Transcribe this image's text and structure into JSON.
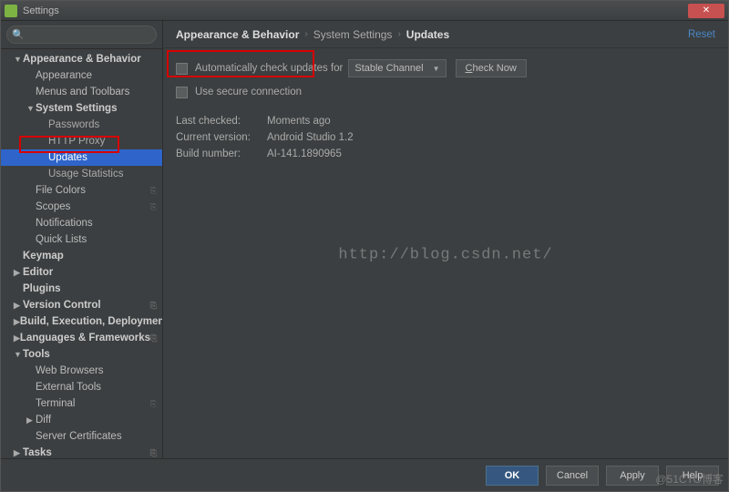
{
  "title": "Settings",
  "search": {
    "placeholder": ""
  },
  "sidebar": {
    "items": [
      {
        "label": "Appearance & Behavior",
        "level": 1,
        "arrow": "▼"
      },
      {
        "label": "Appearance",
        "level": 2,
        "plain": true
      },
      {
        "label": "Menus and Toolbars",
        "level": 2,
        "plain": true
      },
      {
        "label": "System Settings",
        "level": 2,
        "arrow": "▼"
      },
      {
        "label": "Passwords",
        "level": 3
      },
      {
        "label": "HTTP Proxy",
        "level": 3
      },
      {
        "label": "Updates",
        "level": 3,
        "selected": true
      },
      {
        "label": "Usage Statistics",
        "level": 3
      },
      {
        "label": "File Colors",
        "level": 2,
        "plain": true,
        "config": true
      },
      {
        "label": "Scopes",
        "level": 2,
        "plain": true,
        "config": true
      },
      {
        "label": "Notifications",
        "level": 2,
        "plain": true
      },
      {
        "label": "Quick Lists",
        "level": 2,
        "plain": true
      },
      {
        "label": "Keymap",
        "level": 1
      },
      {
        "label": "Editor",
        "level": 1,
        "arrow": "▶"
      },
      {
        "label": "Plugins",
        "level": 1
      },
      {
        "label": "Version Control",
        "level": 1,
        "arrow": "▶",
        "config": true
      },
      {
        "label": "Build, Execution, Deployment",
        "level": 1,
        "arrow": "▶"
      },
      {
        "label": "Languages & Frameworks",
        "level": 1,
        "arrow": "▶",
        "config": true
      },
      {
        "label": "Tools",
        "level": 1,
        "arrow": "▼"
      },
      {
        "label": "Web Browsers",
        "level": 2,
        "plain": true
      },
      {
        "label": "External Tools",
        "level": 2,
        "plain": true
      },
      {
        "label": "Terminal",
        "level": 2,
        "plain": true,
        "config": true
      },
      {
        "label": "Diff",
        "level": 2,
        "plain": true,
        "arrow": "▶"
      },
      {
        "label": "Server Certificates",
        "level": 2,
        "plain": true
      },
      {
        "label": "Tasks",
        "level": 1,
        "arrow": "▶",
        "config": true
      }
    ]
  },
  "breadcrumbs": {
    "a": "Appearance & Behavior",
    "b": "System Settings",
    "c": "Updates",
    "reset": "Reset"
  },
  "content": {
    "auto_check_label": "Automatically check updates for",
    "channel": "Stable Channel",
    "check_now": "Check Now",
    "secure_label": "Use secure connection",
    "info": [
      {
        "k": "Last checked:",
        "v": "Moments ago"
      },
      {
        "k": "Current version:",
        "v": "Android Studio 1.2"
      },
      {
        "k": "Build number:",
        "v": "AI-141.1890965"
      }
    ]
  },
  "footer": {
    "ok": "OK",
    "cancel": "Cancel",
    "apply": "Apply",
    "help": "Help"
  },
  "watermark": "http://blog.csdn.net/",
  "corner_wm": "@51CTO博客"
}
